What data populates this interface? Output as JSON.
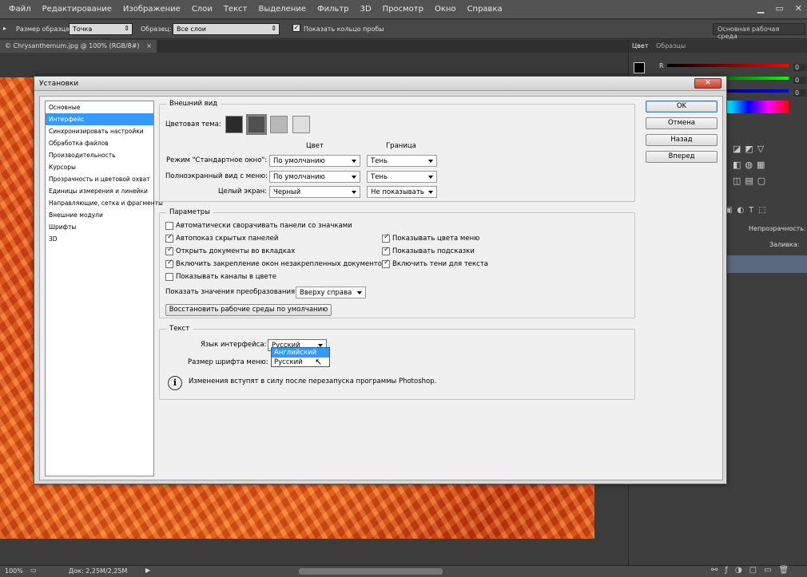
{
  "menubar": {
    "items": [
      "Файл",
      "Редактирование",
      "Изображение",
      "Слои",
      "Текст",
      "Выделение",
      "Фильтр",
      "3D",
      "Просмотр",
      "Окно",
      "Справка"
    ]
  },
  "options": {
    "sample_size_label": "Размер образца:",
    "sample_size_value": "Точка",
    "sample_label": "Образец:",
    "sample_value": "Все слои",
    "show_ring_label": "Показать кольцо пробы",
    "workspace_value": "Основная рабочая среда"
  },
  "document": {
    "tab_title": "© Chrysanthemum.jpg @ 100% (RGB/8#)",
    "close": "×"
  },
  "status": {
    "zoom": "100%",
    "doc_info": "Док: 2,25M/2,25M"
  },
  "right_panel": {
    "tab_color": "Цвет",
    "tab_swatches": "Образцы",
    "channel_r": "R",
    "r_value": "0",
    "g_value": "0",
    "b_value": "0",
    "opacity_label": "Непрозрачность:",
    "fill_label": "Заливка:"
  },
  "dialog": {
    "title": "Установки",
    "categories": [
      "Основные",
      "Интерфейс",
      "Синхронизировать настройки",
      "Обработка файлов",
      "Производительность",
      "Курсоры",
      "Прозрачность и цветовой охват",
      "Единицы измерения и линейки",
      "Направляющие, сетка и фрагменты",
      "Внешние модули",
      "Шрифты",
      "3D"
    ],
    "selected_category": 1,
    "appearance": {
      "legend": "Внешний вид",
      "theme_label": "Цветовая тема:",
      "theme_colors": [
        "#2b2b2b",
        "#505050",
        "#b8b8b8",
        "#dedede"
      ],
      "col_color": "Цвет",
      "col_border": "Граница",
      "row1_label": "Режим \"Стандартное окно\":",
      "row1_color": "По умолчанию",
      "row1_border": "Тень",
      "row2_label": "Полноэкранный вид с меню:",
      "row2_color": "По умолчанию",
      "row2_border": "Тень",
      "row3_label": "Целый экран:",
      "row3_color": "Черный",
      "row3_border": "Не показывать"
    },
    "params": {
      "legend": "Параметры",
      "cb1": "Автоматически сворачивать панели со значками",
      "cb2": "Автопоказ скрытых панелей",
      "cb3": "Открыть документы во вкладках",
      "cb4": "Включить закрепление окон незакрепленных документов",
      "cb5": "Показывать каналы в цвете",
      "cb6": "Показывать цвета меню",
      "cb7": "Показывать подсказки",
      "cb8": "Включить тени для текста",
      "transform_label": "Показать значения преобразования:",
      "transform_value": "Вверху справа",
      "reset_button": "Восстановить рабочие среды по умолчанию"
    },
    "text": {
      "legend": "Текст",
      "lang_label": "Язык интерфейса:",
      "lang_value": "Русский",
      "font_label": "Размер шрифта меню:",
      "dropdown_options": [
        "Английский",
        "Русский"
      ],
      "info": "Изменения вступят в силу после перезапуска программы Photoshop."
    },
    "buttons": {
      "ok": "OK",
      "cancel": "Отмена",
      "back": "Назад",
      "forward": "Вперед"
    }
  }
}
